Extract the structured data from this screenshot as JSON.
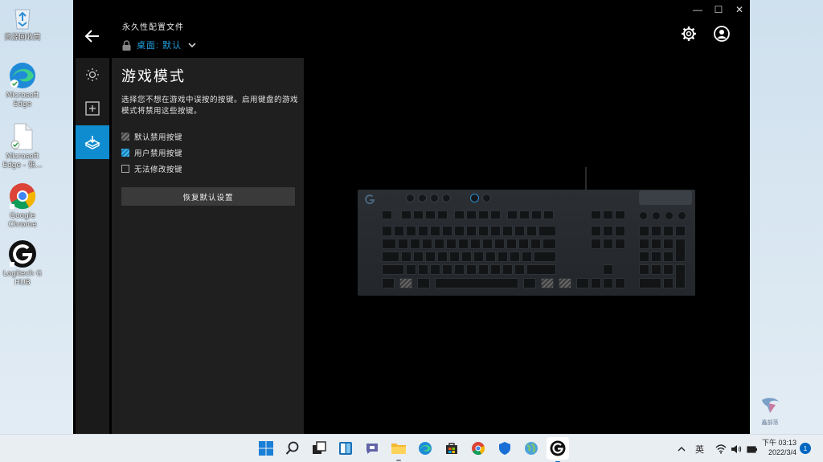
{
  "desktop": {
    "icons": [
      {
        "label": "资源回收筒",
        "icon": "recycle-bin-icon"
      },
      {
        "label": "Microsoft\nEdge",
        "icon": "edge-icon"
      },
      {
        "label": "Microsoft\nEdge - 张...",
        "icon": "document-icon"
      },
      {
        "label": "Google\nChrome",
        "icon": "chrome-icon"
      },
      {
        "label": "Logitech G\nHUB",
        "icon": "logitech-g-icon"
      }
    ]
  },
  "window": {
    "controls": {
      "minimize": "—",
      "maximize": "☐",
      "close": "✕"
    }
  },
  "header": {
    "profile_label": "永久性配置文件",
    "profile_name": "桌面: 默认"
  },
  "rail": {
    "items": [
      {
        "name": "lighting",
        "icon": "sun-icon"
      },
      {
        "name": "assignments",
        "icon": "plus-box-icon"
      },
      {
        "name": "game-mode",
        "icon": "game-mode-icon",
        "active": true
      }
    ]
  },
  "panel": {
    "title": "游戏模式",
    "description": "选择您不想在游戏中误按的按键。启用键盘的游戏模式将禁用这些按键。",
    "legend": [
      {
        "label": "默认禁用按键",
        "swatch": "default"
      },
      {
        "label": "用户禁用按键",
        "swatch": "user"
      },
      {
        "label": "无法修改按键",
        "swatch": "none"
      }
    ],
    "reset_label": "恢复默认设置"
  },
  "colors": {
    "accent": "#0e8ccf",
    "profile_text": "#1fa0e0",
    "window_bg": "#000000",
    "panel_bg": "#1f1f1f"
  },
  "watermark": {
    "label": "鑫部落"
  },
  "taskbar": {
    "apps": [
      "windows-start-icon",
      "search-icon",
      "task-view-icon",
      "widgets-icon",
      "teams-chat-icon",
      "file-explorer-icon",
      "edge-icon",
      "store-icon",
      "chrome-icon",
      "defender-icon",
      "globe-app-icon",
      "logitech-g-icon"
    ],
    "ime": "英",
    "time": "下午 03:13",
    "date": "2022/3/4",
    "notifications": "1"
  }
}
